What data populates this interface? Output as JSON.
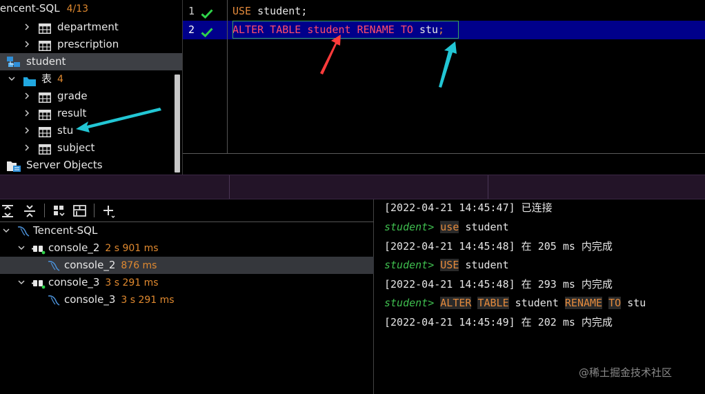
{
  "tree": {
    "header": {
      "label": "tencent-SQL",
      "count": "4/13"
    },
    "items": [
      {
        "label": "department",
        "kind": "table"
      },
      {
        "label": "prescription",
        "kind": "table"
      },
      {
        "label": "student",
        "kind": "schema"
      },
      {
        "label": "表",
        "count": "4",
        "kind": "folder"
      },
      {
        "label": "grade",
        "kind": "table"
      },
      {
        "label": "result",
        "kind": "table"
      },
      {
        "label": "stu",
        "kind": "table"
      },
      {
        "label": "subject",
        "kind": "table"
      },
      {
        "label": "Server Objects",
        "kind": "server"
      }
    ]
  },
  "editor": {
    "lines": [
      {
        "num": "1",
        "kw1": "USE",
        "rest": " student;"
      },
      {
        "num": "2",
        "kw1": "ALTER TABLE",
        "old": "student",
        "kw2": "RENAME TO",
        "new": "stu",
        "semi": ";"
      }
    ]
  },
  "services": {
    "root": "Tencent-SQL",
    "items": [
      {
        "label": "console_2",
        "time": "2 s 901 ms"
      },
      {
        "label": "console_2",
        "time": "876 ms"
      },
      {
        "label": "console_3",
        "time": "3 s 291 ms"
      },
      {
        "label": "console_3",
        "time": "3 s 291 ms"
      }
    ]
  },
  "console": {
    "line1": "[2022-04-21 14:45:47] 已连接",
    "prompt": "student>",
    "cmd1": {
      "kw": "use",
      "rest": " student"
    },
    "line3": "[2022-04-21 14:45:48] 在 205 ms 内完成",
    "cmd2": {
      "kw": "USE",
      "rest": " student"
    },
    "line5": "[2022-04-21 14:45:48] 在 293 ms 内完成",
    "cmd3": {
      "kw1": "ALTER",
      "kw2": "TABLE",
      "mid": " student ",
      "kw3": "RENAME",
      "kw4": "TO",
      "rest": " stu"
    },
    "line7": "[2022-04-21 14:45:49] 在 202 ms 内完成",
    "watermark": "@稀土掘金技术社区"
  },
  "colors": {
    "keyword": "#e48a3c",
    "highlight_red": "#ff4d6a",
    "prompt_green": "#3fbf4f",
    "current_line": "#00008b",
    "arrow_red": "#ff3b3b",
    "arrow_cyan": "#22c6d4"
  }
}
